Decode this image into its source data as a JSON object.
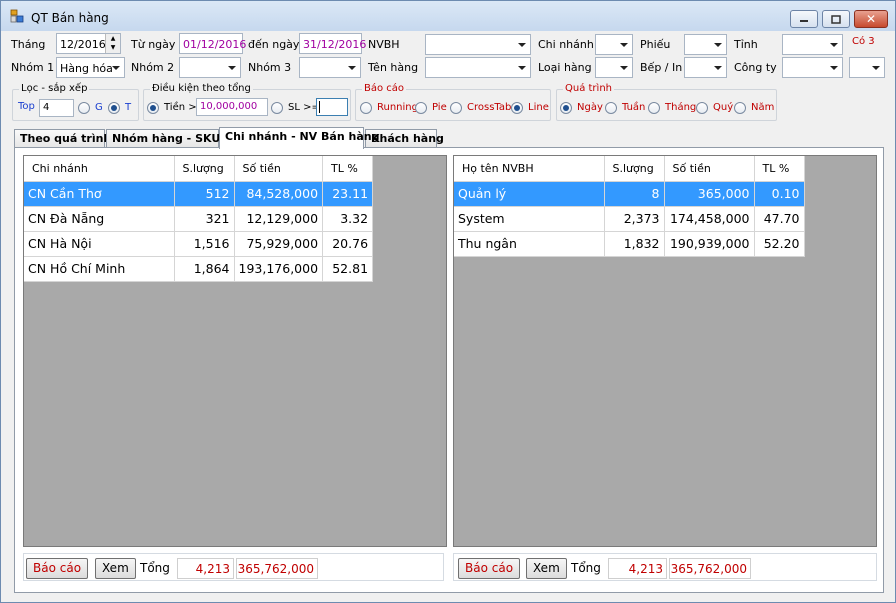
{
  "window": {
    "title": "QT Bán hàng"
  },
  "filters": {
    "thang_label": "Tháng",
    "thang_value": "12/2016",
    "tu_ngay_label": "Từ ngày",
    "tu_ngay_value": "01/12/2016",
    "den_ngay_label": "đến ngày",
    "den_ngay_value": "31/12/2016",
    "nvbh_label": "NVBH",
    "chi_nhanh_label": "Chi nhánh",
    "phieu_label": "Phiếu",
    "tinh_label": "Tỉnh",
    "co_label": "Có 3",
    "nhom1_label": "Nhóm 1",
    "nhom1_value": "Hàng hóa",
    "nhom2_label": "Nhóm 2",
    "nhom3_label": "Nhóm 3",
    "ten_hang_label": "Tên hàng",
    "loai_hang_label": "Loại hàng",
    "bep_in_label": "Bếp / In",
    "cong_ty_label": "Công ty"
  },
  "loc": {
    "title": "Lọc - sắp xếp",
    "top_label": "Top",
    "top_value": "4",
    "g_label": "G",
    "t_label": "T"
  },
  "dieukien": {
    "title": "Điều kiện theo tổng",
    "tien_label": "Tiền >=",
    "tien_value": "10,000,000",
    "sl_label": "SL >="
  },
  "baocao": {
    "title": "Báo cáo",
    "options": [
      "Running",
      "Pie",
      "CrossTab",
      "Line"
    ]
  },
  "quatrinh": {
    "title": "Quá trình",
    "options": [
      "Ngày",
      "Tuần",
      "Tháng",
      "Quý",
      "Năm"
    ]
  },
  "tabs": [
    "Theo quá trình",
    "Nhóm hàng - SKUs",
    "Chi nhánh - NV Bán hàng",
    "Khách hàng"
  ],
  "left_table": {
    "headers": [
      "Chi nhánh",
      "S.lượng",
      "Số tiền",
      "TL %"
    ],
    "rows": [
      [
        "CN Cần Thơ",
        "512",
        "84,528,000",
        "23.11"
      ],
      [
        "CN Đà Nẵng",
        "321",
        "12,129,000",
        "3.32"
      ],
      [
        "CN Hà Nội",
        "1,516",
        "75,929,000",
        "20.76"
      ],
      [
        "CN Hồ Chí Minh",
        "1,864",
        "193,176,000",
        "52.81"
      ]
    ],
    "footer": {
      "bao_cao": "Báo cáo",
      "xem": "Xem",
      "tong_label": "Tổng",
      "tong_sl": "4,213",
      "tong_tien": "365,762,000"
    }
  },
  "right_table": {
    "headers": [
      "Họ tên NVBH",
      "S.lượng",
      "Số tiền",
      "TL %"
    ],
    "rows": [
      [
        "Quản lý",
        "8",
        "365,000",
        "0.10"
      ],
      [
        "System",
        "2,373",
        "174,458,000",
        "47.70"
      ],
      [
        "Thu ngân",
        "1,832",
        "190,939,000",
        "52.20"
      ]
    ],
    "footer": {
      "bao_cao": "Báo cáo",
      "xem": "Xem",
      "tong_label": "Tổng",
      "tong_sl": "4,213",
      "tong_tien": "365,762,000"
    }
  }
}
